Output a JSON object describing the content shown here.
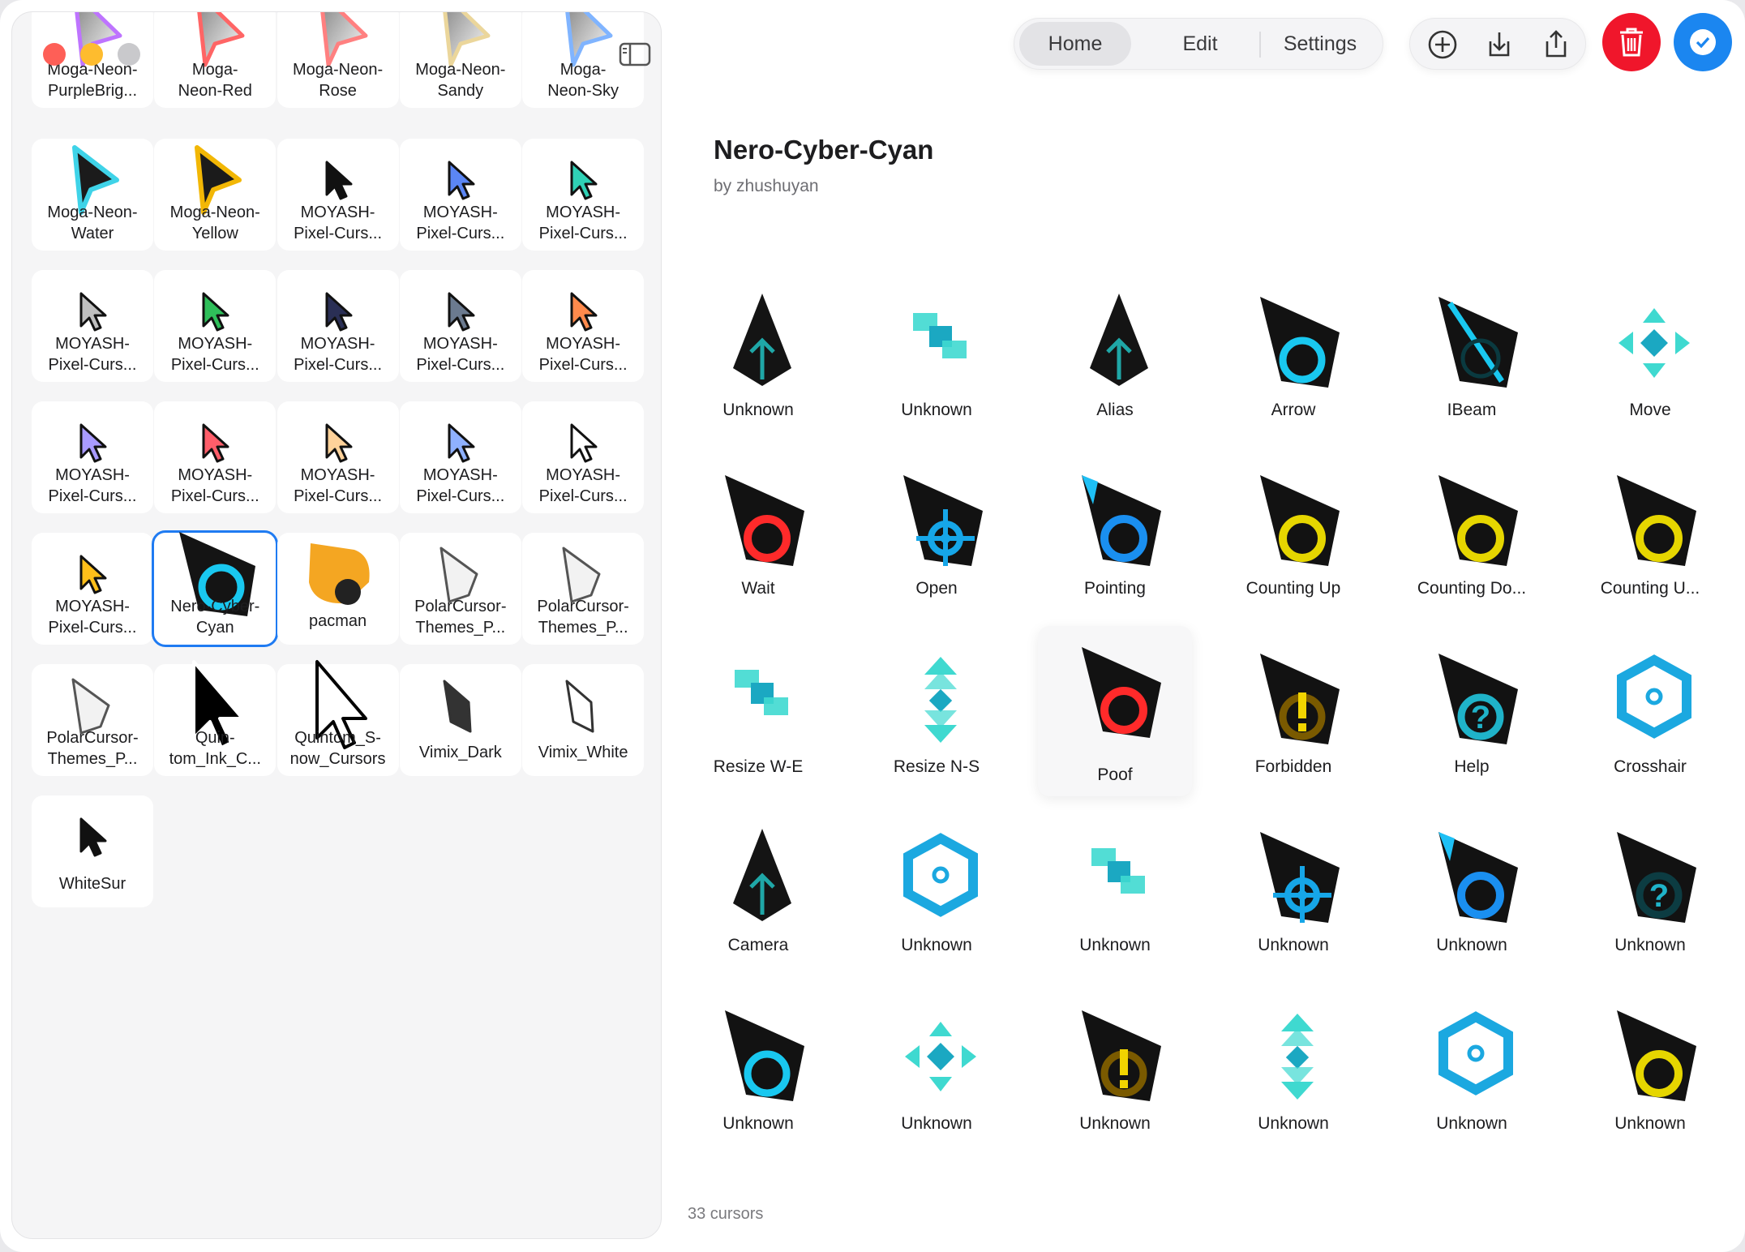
{
  "sidebar": {
    "items": [
      {
        "label": "Moga-Neon-\nPurpleBrig...",
        "icon": "neon-purple-pointer-icon",
        "color": "#b35cff"
      },
      {
        "label": "Moga-\nNeon-Red",
        "icon": "neon-red-pointer-icon",
        "color": "#ff4b4b"
      },
      {
        "label": "Moga-Neon-\nRose",
        "icon": "neon-rose-pointer-icon",
        "color": "#ff6b6b"
      },
      {
        "label": "Moga-Neon-\nSandy",
        "icon": "neon-sandy-pointer-icon",
        "color": "#e8d08a"
      },
      {
        "label": "Moga-\nNeon-Sky",
        "icon": "neon-sky-pointer-icon",
        "color": "#6aa8ff"
      },
      {
        "label": "Moga-Neon-\nWater",
        "icon": "neon-water-pointer-icon",
        "color": "#3fd3e8"
      },
      {
        "label": "Moga-Neon-\nYellow",
        "icon": "neon-yellow-pointer-icon",
        "color": "#f2b705"
      },
      {
        "label": "MOYASH-\nPixel-Curs...",
        "icon": "pixel-black-pointer-icon",
        "color": "#111111"
      },
      {
        "label": "MOYASH-\nPixel-Curs...",
        "icon": "pixel-blue-pointer-icon",
        "color": "#5b86f5"
      },
      {
        "label": "MOYASH-\nPixel-Curs...",
        "icon": "pixel-teal-pointer-icon",
        "color": "#2fd1b5"
      },
      {
        "label": "MOYASH-\nPixel-Curs...",
        "icon": "pixel-gray-pointer-icon",
        "color": "#bfbfbf"
      },
      {
        "label": "MOYASH-\nPixel-Curs...",
        "icon": "pixel-green-pointer-icon",
        "color": "#2fbf5a"
      },
      {
        "label": "MOYASH-\nPixel-Curs...",
        "icon": "pixel-navy-pointer-icon",
        "color": "#2a2f55"
      },
      {
        "label": "MOYASH-\nPixel-Curs...",
        "icon": "pixel-slate-pointer-icon",
        "color": "#6b7a8f"
      },
      {
        "label": "MOYASH-\nPixel-Curs...",
        "icon": "pixel-orange-pointer-icon",
        "color": "#ff8a4c"
      },
      {
        "label": "MOYASH-\nPixel-Curs...",
        "icon": "pixel-lavender-pointer-icon",
        "color": "#a99bff"
      },
      {
        "label": "MOYASH-\nPixel-Curs...",
        "icon": "pixel-coral-pointer-icon",
        "color": "#ff5e6a"
      },
      {
        "label": "MOYASH-\nPixel-Curs...",
        "icon": "pixel-peach-pointer-icon",
        "color": "#ffd29a"
      },
      {
        "label": "MOYASH-\nPixel-Curs...",
        "icon": "pixel-periwinkle-pointer-icon",
        "color": "#8fb1ff"
      },
      {
        "label": "MOYASH-\nPixel-Curs...",
        "icon": "pixel-white-pointer-icon",
        "color": "#ffffff"
      },
      {
        "label": "MOYASH-\nPixel-Curs...",
        "icon": "pixel-yellow-pointer-icon",
        "color": "#ffbf1a"
      },
      {
        "label": "Nero-Cyber-\nCyan",
        "icon": "nero-cyber-cyan-pointer-icon",
        "color": "#19c8f0",
        "selected": true
      },
      {
        "label": "pacman",
        "icon": "pacman-pointer-icon",
        "color": "#f4a622"
      },
      {
        "label": "PolarCursor-\nThemes_P...",
        "icon": "polar-pointer-icon",
        "color": "#f2f2f2"
      },
      {
        "label": "PolarCursor-\nThemes_P...",
        "icon": "polar-pointer-icon",
        "color": "#f2f2f2"
      },
      {
        "label": "PolarCursor-\nThemes_P...",
        "icon": "polar-pointer-icon",
        "color": "#f2f2f2"
      },
      {
        "label": "Quin-\ntom_Ink_C...",
        "icon": "ink-pointer-icon",
        "color": "#000000"
      },
      {
        "label": "Quintom_S-\nnow_Cursors",
        "icon": "snow-pointer-icon",
        "color": "#ffffff"
      },
      {
        "label": "Vimix_Dark",
        "icon": "vimix-dark-pointer-icon",
        "color": "#333333"
      },
      {
        "label": "Vimix_White",
        "icon": "vimix-white-pointer-icon",
        "color": "#ffffff"
      },
      {
        "label": "WhiteSur",
        "icon": "whitesur-pointer-icon",
        "color": "#111111"
      }
    ]
  },
  "toolbar": {
    "tabs": [
      "Home",
      "Edit",
      "Settings"
    ],
    "active_tab": "Home",
    "tools": [
      "add-icon",
      "download-icon",
      "share-icon"
    ],
    "delete_color": "#f0162b",
    "confirm_color": "#1b86f0"
  },
  "theme": {
    "title": "Nero-Cyber-Cyan",
    "author": "by zhushuyan",
    "count": "33 cursors"
  },
  "cursors": [
    {
      "label": "Unknown",
      "kind": "spike"
    },
    {
      "label": "Unknown",
      "kind": "squares"
    },
    {
      "label": "Alias",
      "kind": "spike"
    },
    {
      "label": "Arrow",
      "kind": "ring-cyan"
    },
    {
      "label": "IBeam",
      "kind": "beam"
    },
    {
      "label": "Move",
      "kind": "move"
    },
    {
      "label": "Wait",
      "kind": "ring-red"
    },
    {
      "label": "Open",
      "kind": "crosshair-cyan"
    },
    {
      "label": "Pointing",
      "kind": "ring-blue"
    },
    {
      "label": "Counting Up",
      "kind": "ring-yellow"
    },
    {
      "label": "Counting Do...",
      "kind": "ring-yellow"
    },
    {
      "label": "Counting U...",
      "kind": "ring-yellow"
    },
    {
      "label": "Resize W-E",
      "kind": "squares"
    },
    {
      "label": "Resize N-S",
      "kind": "ns"
    },
    {
      "label": "Poof",
      "kind": "ring-red",
      "hover": true
    },
    {
      "label": "Forbidden",
      "kind": "forbidden"
    },
    {
      "label": "Help",
      "kind": "help"
    },
    {
      "label": "Crosshair",
      "kind": "hexagon"
    },
    {
      "label": "Camera",
      "kind": "spike"
    },
    {
      "label": "Unknown",
      "kind": "hexagon"
    },
    {
      "label": "Unknown",
      "kind": "squares"
    },
    {
      "label": "Unknown",
      "kind": "crosshair-cyan"
    },
    {
      "label": "Unknown",
      "kind": "ring-blue"
    },
    {
      "label": "Unknown",
      "kind": "help-dark"
    },
    {
      "label": "Unknown",
      "kind": "ring-cyan"
    },
    {
      "label": "Unknown",
      "kind": "move"
    },
    {
      "label": "Unknown",
      "kind": "forbidden"
    },
    {
      "label": "Unknown",
      "kind": "ns"
    },
    {
      "label": "Unknown",
      "kind": "hexagon"
    },
    {
      "label": "Unknown",
      "kind": "ring-yellow"
    }
  ]
}
